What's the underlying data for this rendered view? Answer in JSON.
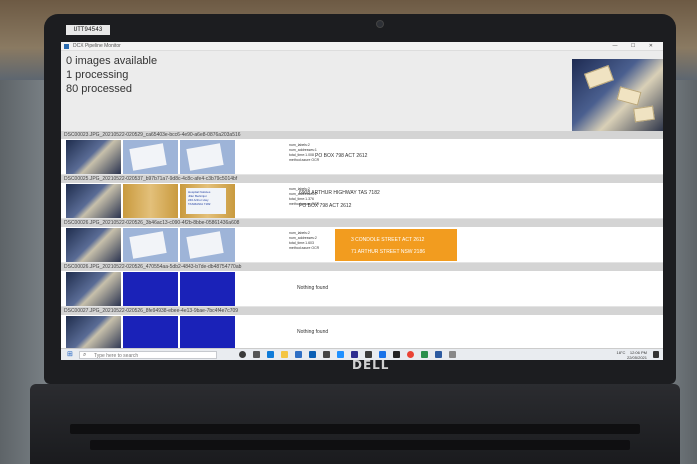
{
  "device": {
    "asset_tag": "UTT94543",
    "bezel_logo": "DELL"
  },
  "window": {
    "title": "DCX Pipeline Monitor",
    "controls": "—  ☐  ✕"
  },
  "status": {
    "available": "0 images available",
    "processing": "1 processing",
    "processed": "80 processed"
  },
  "rows": [
    {
      "label": "DSC00023.JPG_20210522-020529_ca65403e-bcc6-4e90-a6e8-0876a203a516",
      "meta": "num_labels:2\nnum_addresses:1\ntotal_time:1.008\nmethod:azure OCR",
      "addresses": [
        "PO BOX 798 ACT 2612"
      ],
      "highlight": false,
      "nothing_found": ""
    },
    {
      "label": "DSC00025.JPG_20210522-020537_b97b71a7-9d8c-4c8c-afe4-c3b79c5014bf",
      "meta": "num_labels:2\nnum_addresses:2\ntotal_time:1.376\nmethod:azure OCR",
      "addresses": [
        "6908 ARTHUR HIGHWAY TAS 7182",
        "PO BOX 798 ACT 2612"
      ],
      "highlight": false,
      "nothing_found": "",
      "crop_text": "Hospital Noticies\nJiller Berkinjui\n246 Arthur Hwy\nTASMANIA 7182"
    },
    {
      "label": "DSC00026.JPG_20210522-020526_3b46ac13-c090-4f2b-8bbe-05861436a608",
      "meta": "num_labels:2\nnum_addresses:2\ntotal_time:1.603\nmethod:azure OCR",
      "addresses": [
        "3 CONDOLE STREET ACT 2612",
        "71 ARTHUR STREET NSW 2186"
      ],
      "highlight": true,
      "nothing_found": ""
    },
    {
      "label": "DSC00026.JPG_20210522-020526_470554aa-5db2-4843-b7de-db48754770ab",
      "meta": "",
      "addresses": [],
      "highlight": false,
      "nothing_found": "Nothing found"
    },
    {
      "label": "DSC00027.JPG_20210522-020526_8fe94938-ebee-4e13-9bae-7bc4f4e7c709",
      "meta": "",
      "addresses": [],
      "highlight": false,
      "nothing_found": "Nothing found"
    }
  ],
  "taskbar": {
    "search_placeholder": "Type here to search",
    "tray_time": "12:06 PM",
    "tray_date": "22/05/2021",
    "tray_temp": "18°C"
  },
  "colors": {
    "highlight": "#f29c1f",
    "blue_placeholder": "#1a22b8"
  }
}
